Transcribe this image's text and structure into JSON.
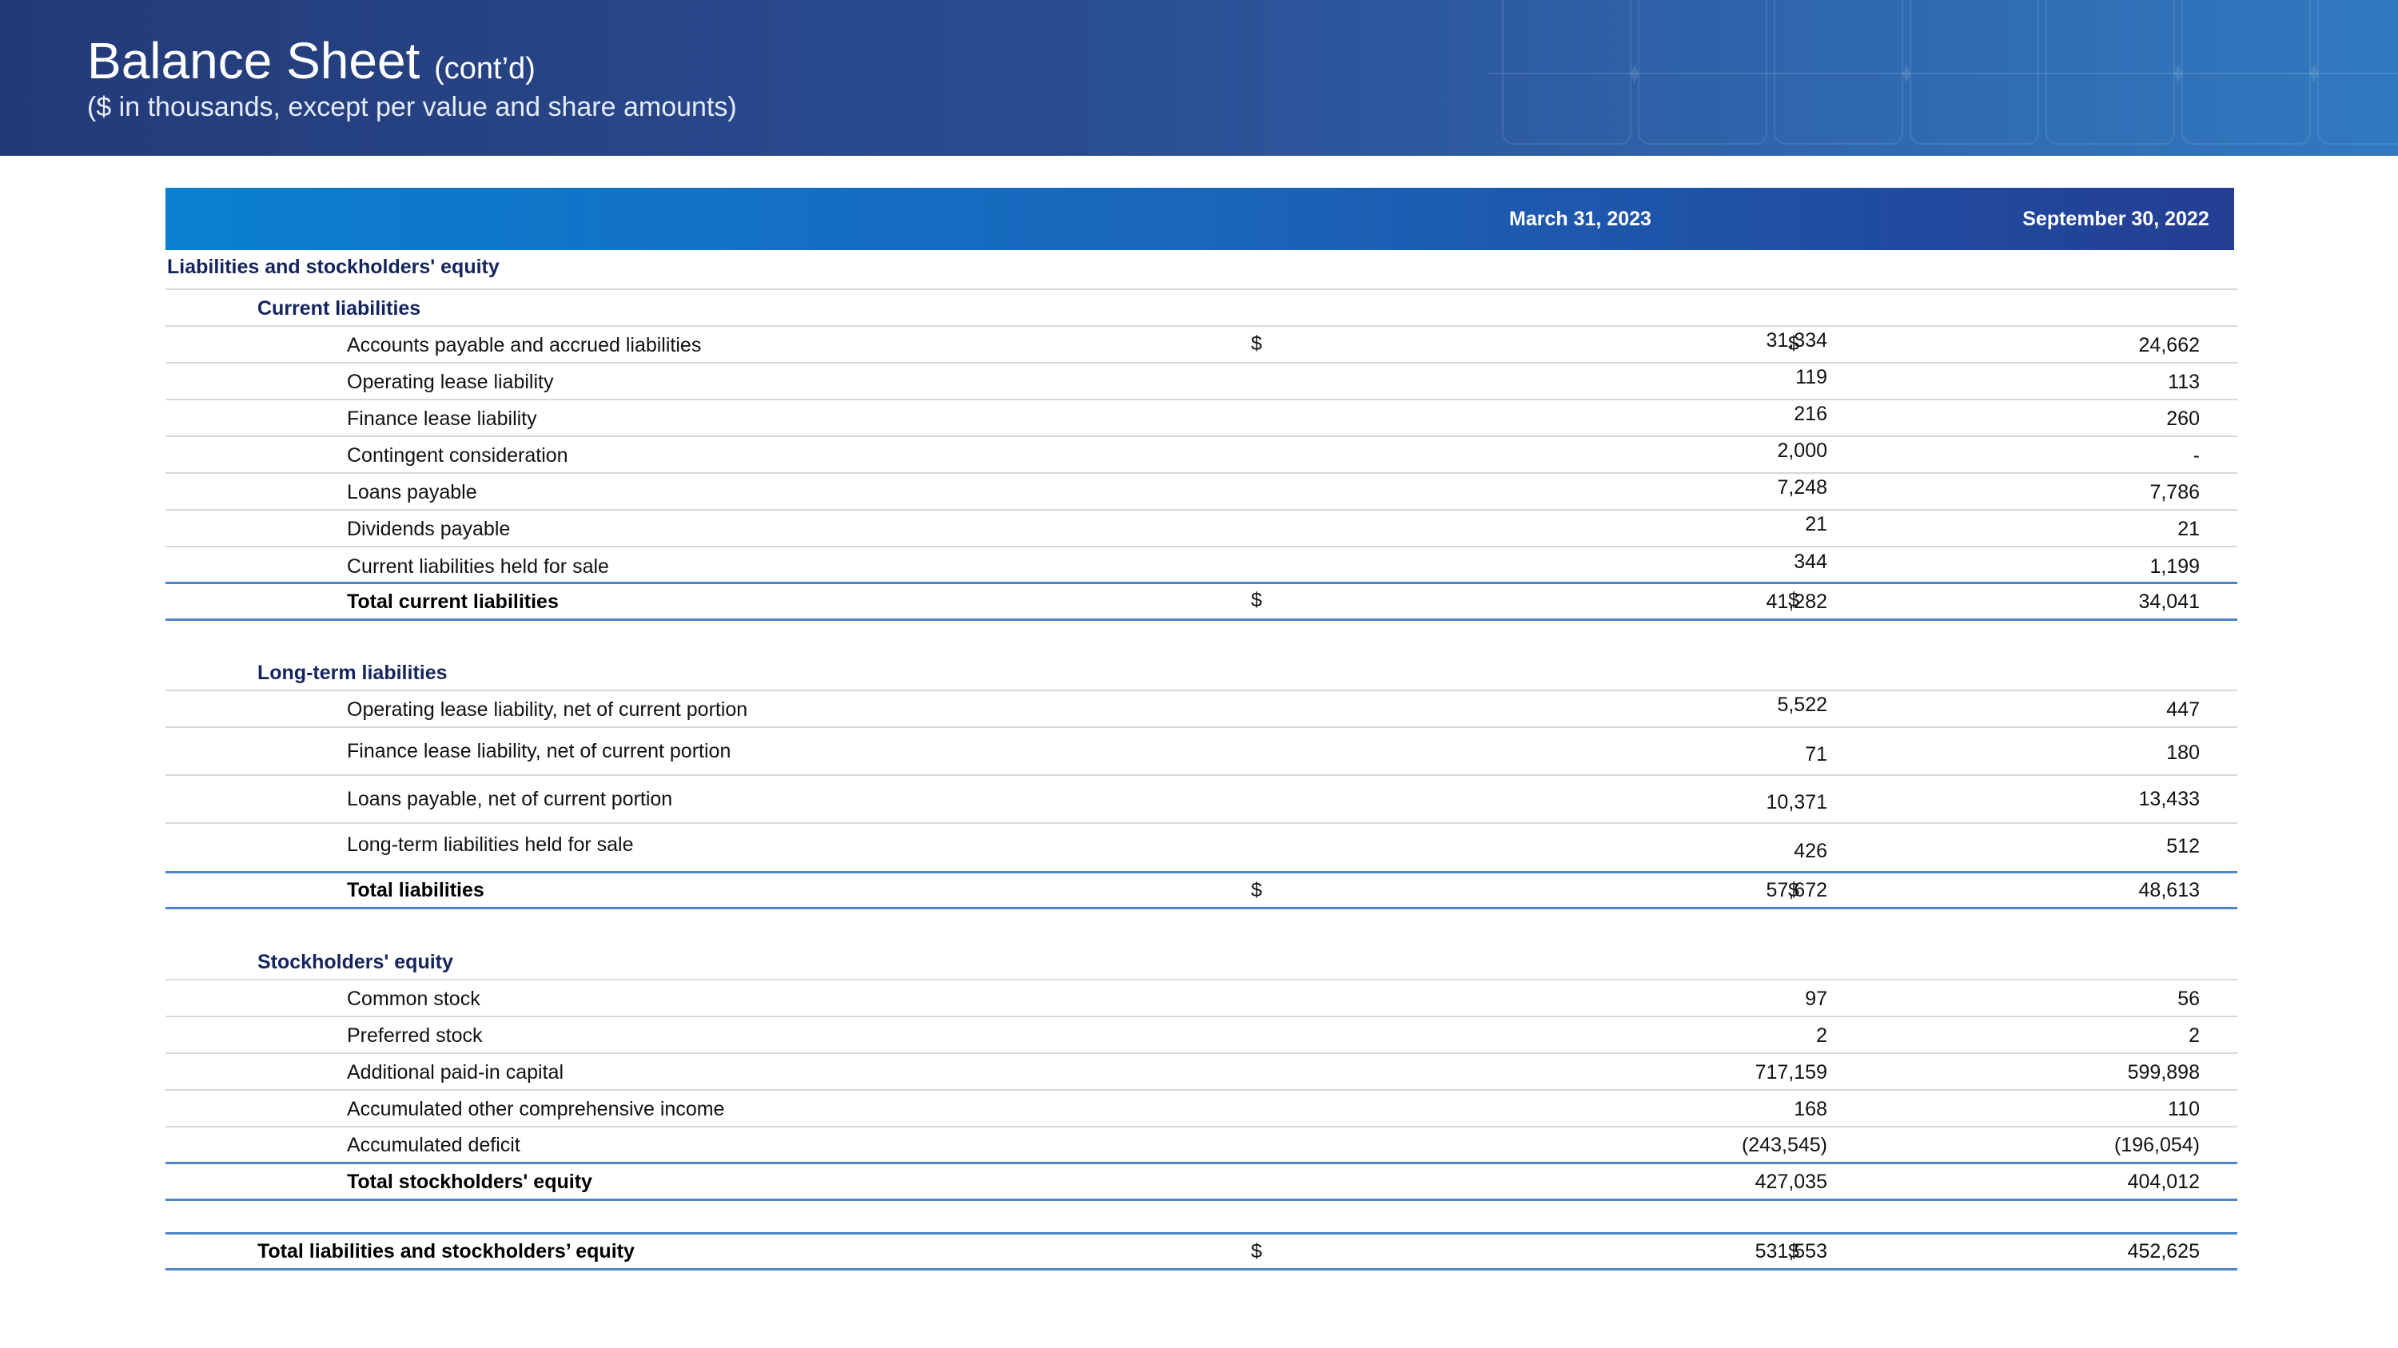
{
  "header": {
    "title": "Balance Sheet",
    "title_suffix": "(cont’d)",
    "subtitle": "($ in thousands, except per value and share amounts)"
  },
  "table": {
    "columns": [
      "March 31, 2023",
      "September 30, 2022"
    ],
    "sections": {
      "main_label": "Liabilities and stockholders' equity",
      "current_liabilities": {
        "label": "Current liabilities",
        "rows": [
          {
            "label": "Accounts payable and accrued liabilities",
            "cur1": "$",
            "v1": "31,334",
            "cur2": "$",
            "v2": "24,662"
          },
          {
            "label": "Operating lease liability",
            "v1": "119",
            "v2": "113"
          },
          {
            "label": "Finance lease liability",
            "v1": "216",
            "v2": "260"
          },
          {
            "label": "Contingent consideration",
            "v1": "2,000",
            "v2": "-"
          },
          {
            "label": "Loans payable",
            "v1": "7,248",
            "v2": "7,786"
          },
          {
            "label": "Dividends payable",
            "v1": "21",
            "v2": "21"
          },
          {
            "label": "Current liabilities held for sale",
            "v1": "344",
            "v2": "1,199"
          }
        ],
        "total": {
          "label": "Total current liabilities",
          "cur1": "$",
          "v1": "41,282",
          "cur2": "$",
          "v2": "34,041"
        }
      },
      "long_term_liabilities": {
        "label": "Long-term liabilities",
        "rows": [
          {
            "label": "Operating lease liability, net of current portion",
            "v1": "5,522",
            "v2": "447"
          },
          {
            "label": "Finance lease liability, net of current portion",
            "v1": "71",
            "v2": "180"
          },
          {
            "label": "Loans payable, net of current portion",
            "v1": "10,371",
            "v2": "13,433"
          },
          {
            "label": "Long-term liabilities held for sale",
            "v1": "426",
            "v2": "512"
          }
        ],
        "total": {
          "label": "Total liabilities",
          "cur1": "$",
          "v1": "57,672",
          "cur2": "$",
          "v2": "48,613"
        }
      },
      "stockholders_equity": {
        "label": "Stockholders' equity",
        "rows": [
          {
            "label": "Common stock",
            "v1": "97",
            "v2": "56"
          },
          {
            "label": "Preferred stock",
            "v1": "2",
            "v2": "2"
          },
          {
            "label": "Additional paid-in capital",
            "v1": "717,159",
            "v2": "599,898"
          },
          {
            "label": "Accumulated other comprehensive income",
            "v1": "168",
            "v2": "110"
          },
          {
            "label": "Accumulated deficit",
            "v1": "(243,545)",
            "v2": "(196,054)"
          }
        ],
        "total": {
          "label": "Total stockholders' equity",
          "v1": "427,035",
          "v2": "404,012"
        }
      },
      "grand_total": {
        "label": "Total liabilities and stockholders’ equity",
        "cur1": "$",
        "v1": "531,553",
        "cur2": "$",
        "v2": "452,625"
      }
    }
  },
  "colors": {
    "header_start": "#233a78",
    "header_end": "#3079c0",
    "table_head_start": "#0a7fd0",
    "table_head_end": "#243e92",
    "section_label": "#14255e",
    "rule_blue": "#4f86c9"
  }
}
